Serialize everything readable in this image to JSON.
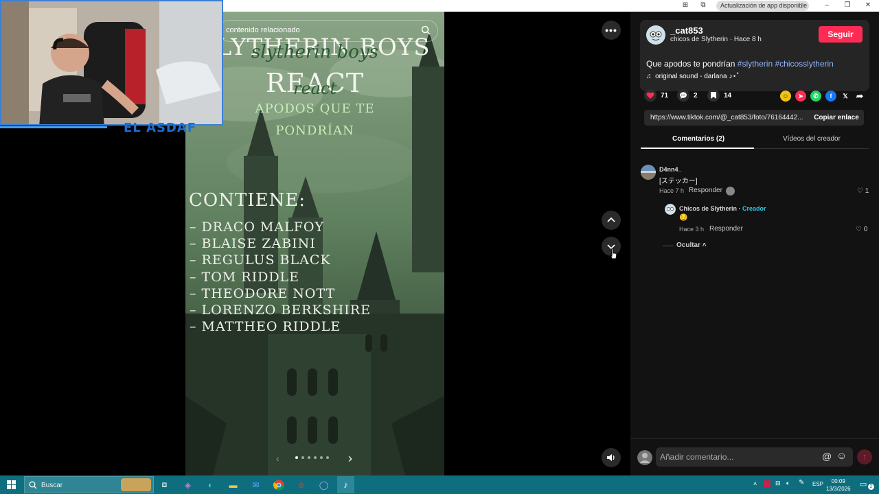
{
  "topbar": {
    "update_label": "Actualización de app disponible",
    "colors": {
      "bg": "#ffffff",
      "pill": "#dcdcdc"
    }
  },
  "video": {
    "related_search": "contenido relacionado",
    "slide": {
      "title_line1": "SLYTHERIN BOYS",
      "title_script1": "slytherin boys",
      "title_line2": "REACT",
      "title_script2": "react",
      "subtitle_line1": "APODOS QUE TE",
      "subtitle_line2": "PONDRÍAN",
      "contains_heading": "CONTIENE:",
      "names": [
        "– DRACO MALFOY",
        "– BLAISE ZABINI",
        "– REGULUS BLACK",
        "– TOM RIDDLE",
        "– THEODORE NOTT",
        "– LORENZO BERKSHIRE",
        "– MATTHEO RIDDLE"
      ],
      "dot_count": 6,
      "active_dot": 0
    },
    "icons": {
      "more": "more-icon",
      "prev": "chevron-up-icon",
      "next": "chevron-down-icon",
      "volume": "volume-icon",
      "slide_next": "chevron-right-icon",
      "slide_prev": "chevron-left-icon"
    }
  },
  "webcam": {
    "overlay_tag": "EL ASDAF"
  },
  "post": {
    "author": "_cat853",
    "meta": "chicos de Slytherin · Hace 8 h",
    "follow_label": "Seguir",
    "caption_text": "Que apodos te pondrían ",
    "hashtags": [
      "#slytherin",
      "#chicosslytherin"
    ],
    "sound": "original sound - darlana ♪⋆˚",
    "likes": "71",
    "comments": "2",
    "saves": "14",
    "link": "https://www.tiktok.com/@_cat853/foto/76164442...",
    "copy_label": "Copiar enlace",
    "colors": {
      "accent": "#fe2c55",
      "hashtag": "#8fb7ff"
    }
  },
  "tabs": {
    "comments": "Comentarios (2)",
    "videos": "Vídeos del creador"
  },
  "comments": [
    {
      "author": "D4nn4_",
      "text": "[ステッカー]",
      "time": "Hace 7 h",
      "reply_label": "Responder",
      "likes": "1"
    }
  ],
  "reply": {
    "author": "Chicos de Slytherin",
    "separator": " · ",
    "creator_badge": "Creador",
    "text": "😏",
    "time": "Hace 3 h",
    "reply_label": "Responder",
    "likes": "0",
    "hide_label": "Ocultar"
  },
  "comment_input": {
    "placeholder": "Añadir comentario..."
  },
  "taskbar": {
    "search_label": "Buscar",
    "lang": "ESP",
    "time": "00:09",
    "date": "13/3/2026",
    "notifications": "2"
  }
}
